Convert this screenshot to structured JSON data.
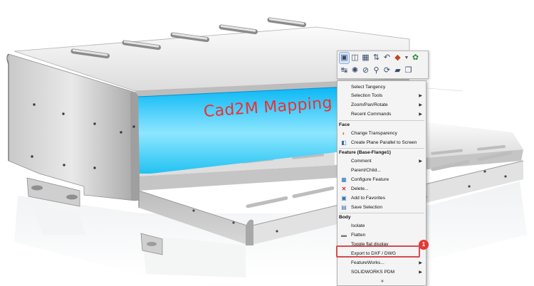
{
  "watermark": "Cad2M Mapping",
  "callout": "1",
  "toolbar": {
    "row1": [
      "view-orientation-icon",
      "section-view-icon",
      "zoom-to-fit-icon",
      "measure-icon",
      "rollback-icon",
      "appearance-icon",
      "dropdown-arrow-icon",
      "display-style-icon"
    ],
    "row2": [
      "normal-to-icon",
      "sketch-icon",
      "hide-icon",
      "zoom-to-selection-icon",
      "rebuild-icon",
      "edit-feature-icon",
      "component-icon"
    ]
  },
  "menu": {
    "select_tangency": "Select Tangency",
    "selection_tools": "Selection Tools",
    "zoom_pan_rotate": "Zoom/Pan/Rotate",
    "recent_commands": "Recent Commands",
    "face_header": "Face",
    "change_transparency": "Change Transparency",
    "create_plane": "Create Plane Parallel to Screen",
    "feature_header": "Feature (Base-Flange1)",
    "comment": "Comment",
    "parent_child": "Parent/Child...",
    "configure_feature": "Configure Feature",
    "delete": "Delete...",
    "add_favorites": "Add to Favorites",
    "save_selection": "Save Selection",
    "body_header": "Body",
    "isolate": "Isolate",
    "flatten": "Flatten",
    "toggle_flat": "Toggle flat display",
    "export_dxf": "Export to DXF / DWG",
    "featureworks": "FeatureWorks...",
    "solidworks_pdm": "SOLIDWORKS PDM",
    "more": "»"
  },
  "colors": {
    "selected_face": "#1ec8ff",
    "highlight": "#d84b4b",
    "badge": "#e53935",
    "watermark": "#ee3030"
  }
}
